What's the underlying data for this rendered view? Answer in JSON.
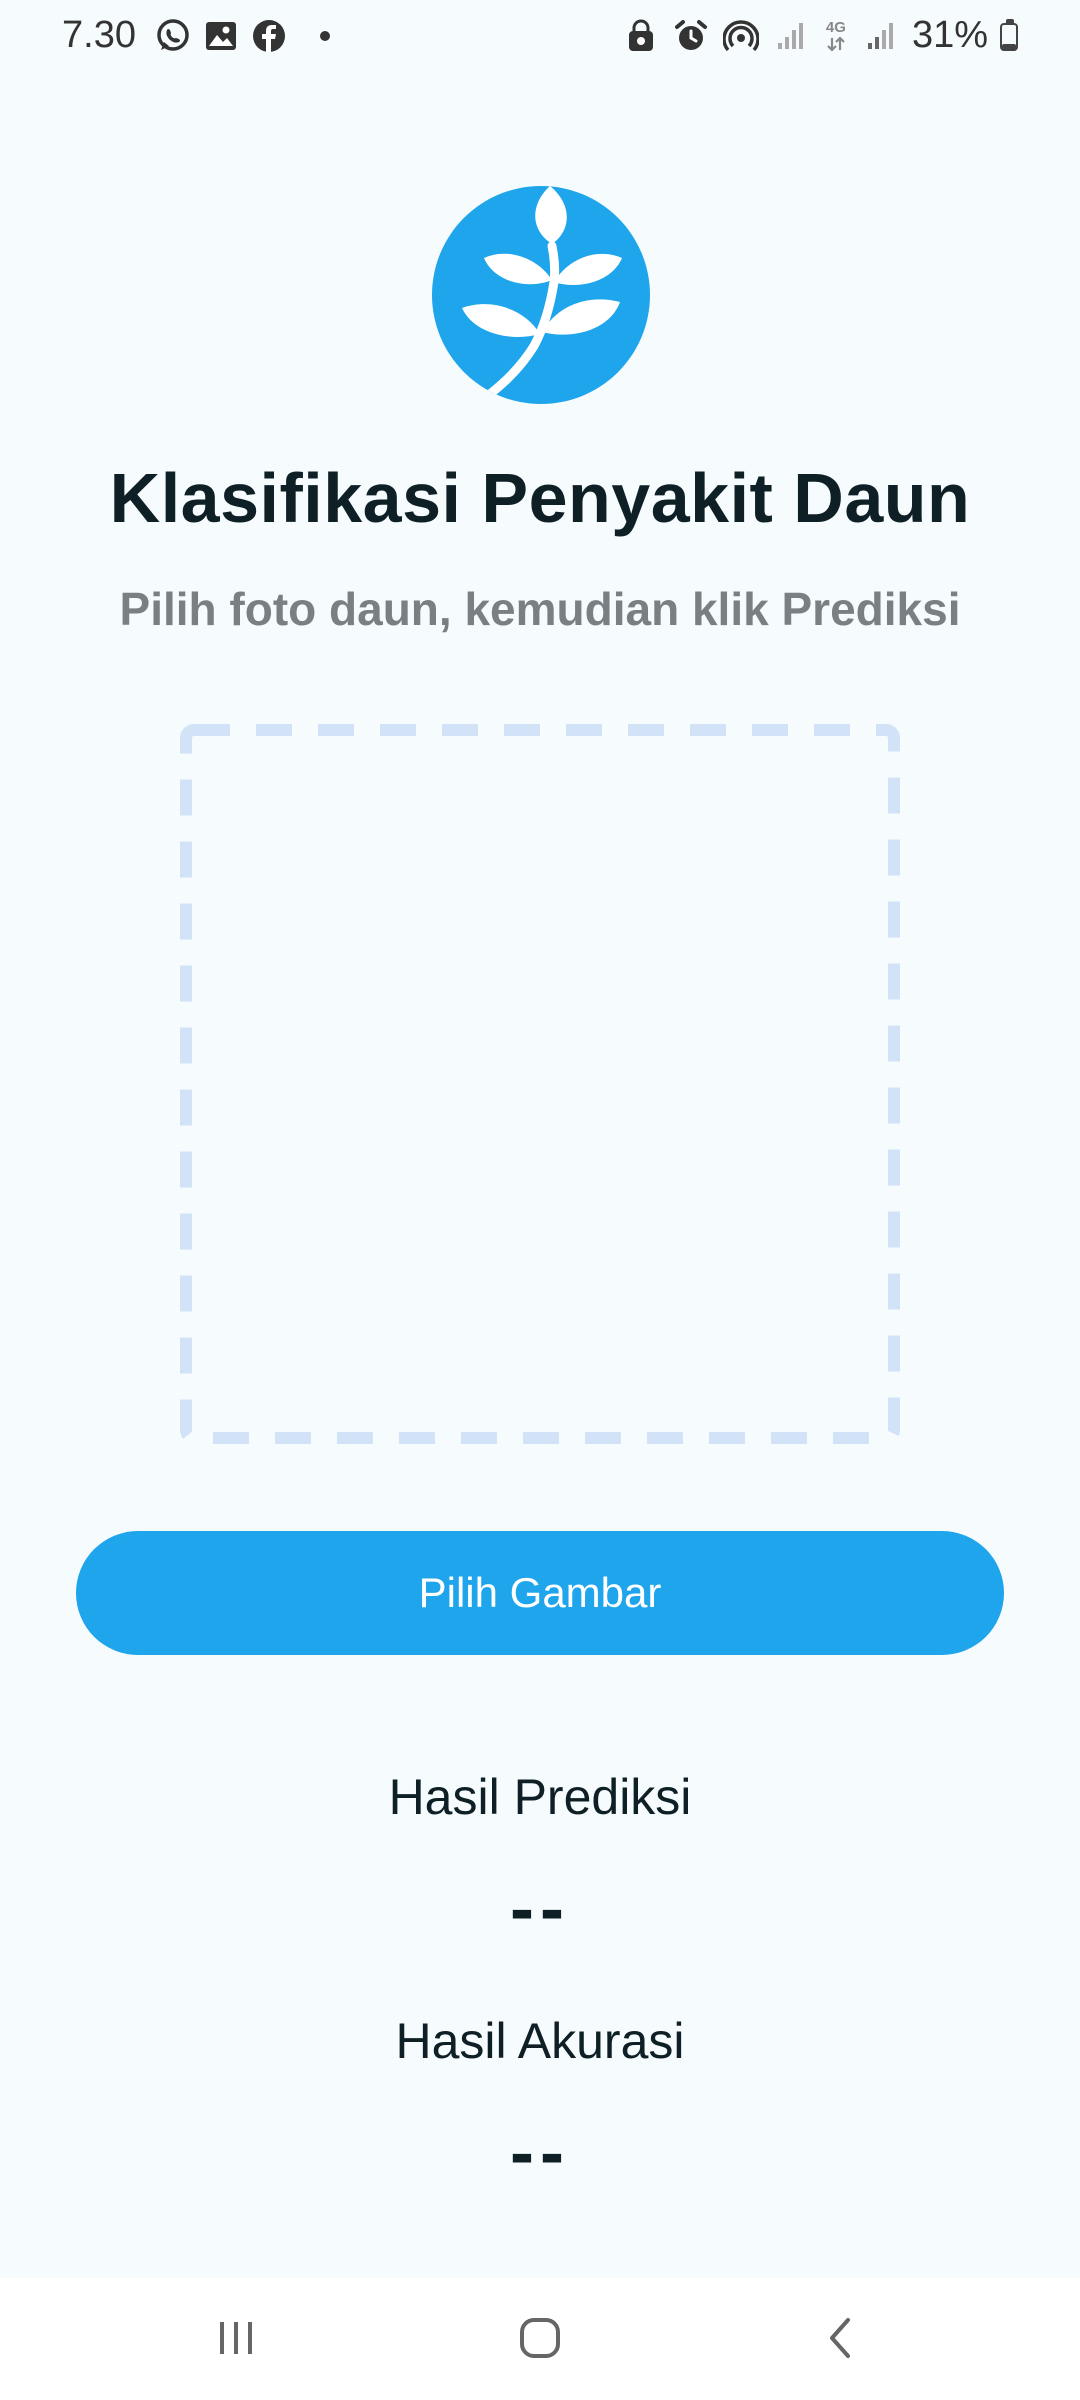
{
  "status_bar": {
    "time": "7.30",
    "left_icons": [
      "whatsapp-icon",
      "gallery-icon",
      "facebook-icon"
    ],
    "right_icons": [
      "vpn-lock-icon",
      "alarm-icon",
      "hotspot-icon",
      "signal-icon",
      "network-4g-icon",
      "signal-icon"
    ],
    "network_label": "4G",
    "battery_percent": "31%",
    "battery_level": 0.31
  },
  "header": {
    "logo_icon": "leaf-icon",
    "title": "Klasifikasi Penyakit Daun",
    "subtitle": "Pilih foto daun, kemudian klik Prediksi"
  },
  "image_area": {
    "state": "empty",
    "border_color": "#D2E3F8"
  },
  "actions": {
    "pick_image_label": "Pilih Gambar"
  },
  "results": {
    "prediction_label": "Hasil Prediksi",
    "prediction_value": "--",
    "accuracy_label": "Hasil Akurasi",
    "accuracy_value": "--"
  },
  "nav_bar": {
    "buttons": [
      "recent-apps-icon",
      "home-icon",
      "back-icon"
    ]
  },
  "colors": {
    "accent": "#1EA5EB",
    "background": "#F6FBFE",
    "title_text": "#0E1F26",
    "subtitle_text": "#7A7F83"
  }
}
